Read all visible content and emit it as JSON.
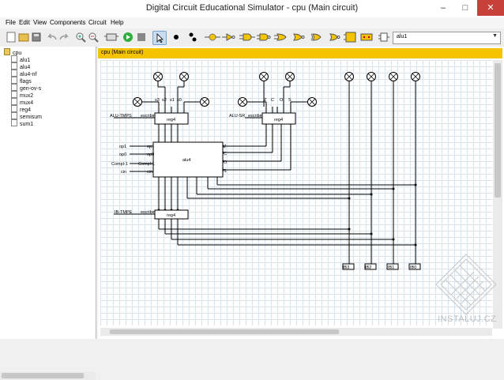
{
  "window": {
    "title": "Digital Circuit Educational Simulator -  cpu  (Main circuit)"
  },
  "menu": [
    "File",
    "Edit",
    "View",
    "Components",
    "Circuit",
    "Help"
  ],
  "toolbar": {
    "icons": [
      "new-icon",
      "open-icon",
      "save-icon",
      "undo-icon",
      "redo-icon",
      "zoom-in-icon",
      "zoom-out-icon",
      "chip-icon",
      "run-icon",
      "stop-icon",
      "select-arrow-icon",
      "wire-point-icon",
      "node-icon",
      "switch-icon",
      "not-gate-icon",
      "and-gate-icon",
      "nand-gate-icon",
      "or-gate-icon",
      "nor-gate-icon",
      "xor-gate-icon",
      "buffer-icon",
      "flip-flop-icon",
      "register-icon",
      "chip-select-icon"
    ],
    "circuit_select": "alu1"
  },
  "tree": {
    "root": "cpu",
    "items": [
      "alu1",
      "alu4",
      "alu4-nf",
      "flags",
      "gen-ov-s",
      "mux2",
      "mux4",
      "reg4",
      "semisum",
      "sum1"
    ]
  },
  "canvas": {
    "header": "cpu (Main circuit)",
    "labels": {
      "reg_top": "reg4",
      "reg_sr": "reg4",
      "reg_bottom": "reg4",
      "alu": "alu4",
      "escribir": "escribir",
      "alu_tmps": "ALU-TMPS",
      "alu_sr": "ALU-SR",
      "ib_tmpe": "IB-TMPE",
      "op1": "op1",
      "op0": "op0",
      "compl1": "Compl-1",
      "cin": "cin",
      "compl1_port": "Compl-1",
      "flag_z": "Z",
      "flag_c": "C",
      "flag_o": "O",
      "flag_s": "S",
      "s3": "s3",
      "s2": "s2",
      "s1": "s1",
      "s0": "s0",
      "ib3": "IB3",
      "ib2": "IB2",
      "ib1": "IB1",
      "ib0": "IB0"
    }
  },
  "watermark": "INSTALUJ.CZ"
}
